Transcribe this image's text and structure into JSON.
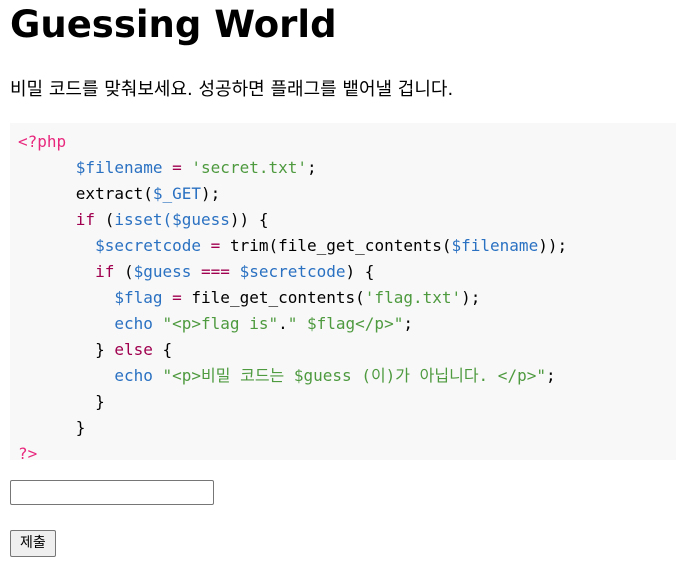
{
  "page": {
    "title": "Guessing World",
    "description": "비밀 코드를 맞춰보세요. 성공하면 플래그를 뱉어낼 겁니다."
  },
  "code": {
    "line1": {
      "open_tag": "<?php"
    },
    "line2": {
      "indent": "      ",
      "var": "$filename",
      "op": " = ",
      "str": "'secret.txt'",
      "end": ";"
    },
    "line3": {
      "indent": "      ",
      "fn": "extract(",
      "var": "$_GET",
      "end": ");"
    },
    "line4": {
      "indent": "      ",
      "kw": "if",
      "p1": " (",
      "fn": "isset(",
      "var": "$guess",
      "end": ")) {"
    },
    "line5": {
      "indent": "        ",
      "var1": "$secretcode",
      "op": " = ",
      "fn1": "trim(",
      "fn2": "file_get_contents(",
      "var2": "$filename",
      "end": "));"
    },
    "line6": {
      "indent": "        ",
      "kw": "if",
      "p1": " (",
      "var1": "$guess",
      "op": " === ",
      "var2": "$secretcode",
      "end": ") {"
    },
    "line7": {
      "indent": "          ",
      "var1": "$flag",
      "op": " = ",
      "fn": "file_get_contents(",
      "str": "'flag.txt'",
      "end": ");"
    },
    "line8": {
      "indent": "          ",
      "kw": "echo",
      "sp": " ",
      "str1": "\"<p>flag is\"",
      "dot": ".",
      "str2": "\" $flag</p>\"",
      "end": ";"
    },
    "line9": {
      "indent": "        ",
      "brace": "} ",
      "kw": "else",
      "end": " {"
    },
    "line10": {
      "indent": "          ",
      "kw": "echo",
      "sp": " ",
      "str": "\"<p>비밀 코드는 $guess (이)가 아닙니다. </p>\"",
      "end": ";"
    },
    "line11": {
      "indent": "        ",
      "end": "}"
    },
    "line12": {
      "indent": "      ",
      "end": "}"
    },
    "line13": {
      "close_tag": "?>"
    }
  },
  "form": {
    "input_value": "",
    "submit_label": "제출"
  }
}
